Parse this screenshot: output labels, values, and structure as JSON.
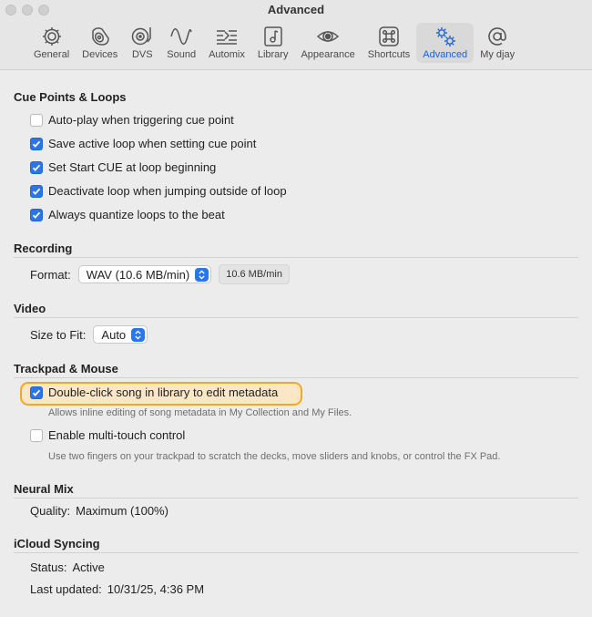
{
  "window": {
    "title": "Advanced"
  },
  "toolbar": {
    "items": [
      {
        "label": "General",
        "icon": "gear-icon"
      },
      {
        "label": "Devices",
        "icon": "speaker-icon"
      },
      {
        "label": "DVS",
        "icon": "turntable-icon"
      },
      {
        "label": "Sound",
        "icon": "waveform-icon"
      },
      {
        "label": "Automix",
        "icon": "automix-icon"
      },
      {
        "label": "Library",
        "icon": "music-note-icon"
      },
      {
        "label": "Appearance",
        "icon": "eye-icon"
      },
      {
        "label": "Shortcuts",
        "icon": "command-key-icon"
      },
      {
        "label": "Advanced",
        "icon": "gears-icon",
        "active": true
      },
      {
        "label": "My djay",
        "icon": "at-sign-icon"
      }
    ],
    "accent": "#1a62d6"
  },
  "cue": {
    "title": "Cue Points & Loops",
    "items": [
      {
        "label": "Auto-play when triggering cue point",
        "checked": false
      },
      {
        "label": "Save active loop when setting cue point",
        "checked": true
      },
      {
        "label": "Set Start CUE at loop beginning",
        "checked": true
      },
      {
        "label": "Deactivate loop when jumping outside of loop",
        "checked": true
      },
      {
        "label": "Always quantize loops to the beat",
        "checked": true
      }
    ]
  },
  "recording": {
    "title": "Recording",
    "format_label": "Format:",
    "format_value": "WAV (10.6 MB/min)",
    "rate_readout": "10.6 MB/min"
  },
  "video": {
    "title": "Video",
    "fit_label": "Size to Fit:",
    "fit_value": "Auto"
  },
  "trackpad": {
    "title": "Trackpad & Mouse",
    "double_click": {
      "label": "Double-click song in library to edit metadata",
      "checked": true
    },
    "double_click_help": "Allows inline editing of song metadata in My Collection and My Files.",
    "multitouch": {
      "label": "Enable multi-touch control",
      "checked": false
    },
    "multitouch_help": "Use two fingers on your trackpad to scratch the decks, move sliders and knobs, or control the FX Pad.",
    "highlight_color": "#f4a624"
  },
  "neural": {
    "title": "Neural Mix",
    "quality_label": "Quality:",
    "quality_value": "Maximum (100%)"
  },
  "icloud": {
    "title": "iCloud Syncing",
    "status_label": "Status:",
    "status_value": "Active",
    "updated_label": "Last updated:",
    "updated_value": "10/31/25, 4:36 PM"
  }
}
